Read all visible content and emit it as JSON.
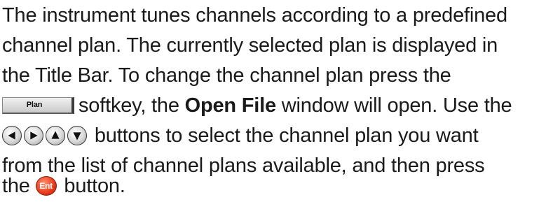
{
  "paragraph": {
    "line1": "The instrument tunes channels according to a predefined",
    "line2": "channel plan. The currently selected plan is displayed in",
    "line3": "the Title Bar. To change the channel plan press the",
    "line4_after_key": "softkey, the ",
    "line4_bold": "Open File",
    "line4_end": " window will open. Use the",
    "line5_after_buttons": " buttons to select the channel plan you want",
    "line6": "from the list of channel plans available, and then press",
    "line7_start": "the ",
    "line7_end": " button."
  },
  "softkey": {
    "label": "Plan"
  },
  "nav_buttons": [
    {
      "icon": "arrow-left-icon"
    },
    {
      "icon": "arrow-right-icon"
    },
    {
      "icon": "arrow-up-icon"
    },
    {
      "icon": "arrow-down-icon"
    }
  ],
  "enter_button": {
    "label": "Ent",
    "color": "#e8391b"
  }
}
